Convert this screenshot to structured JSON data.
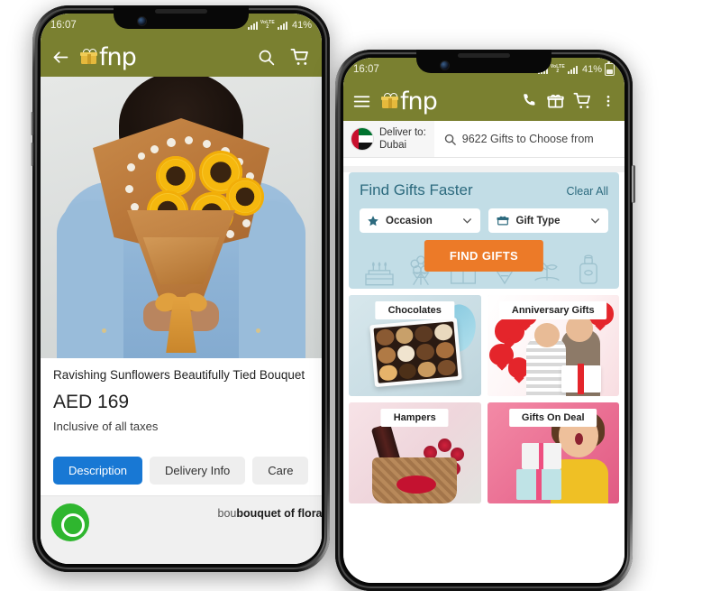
{
  "left_phone": {
    "status_bar": {
      "time": "16:07",
      "network1": "VoLTE1",
      "network2": "VoLTE2",
      "battery": "41%"
    },
    "app_bar": {
      "back_icon": "arrow-left-icon",
      "brand": "fnp",
      "search_icon": "search-icon",
      "cart_icon": "cart-icon"
    },
    "product": {
      "title": "Ravishing Sunflowers Beautifully Tied Bouquet",
      "price": "AED 169",
      "tax_note": "Inclusive of all taxes",
      "image_alt": "sunflower-bouquet-photo"
    },
    "tabs": [
      {
        "label": "Description",
        "active": true
      },
      {
        "label": "Delivery Info",
        "active": false
      },
      {
        "label": "Care",
        "active": false
      }
    ],
    "description_snippet": "bouquet of floral",
    "whatsapp_icon": "whatsapp-icon"
  },
  "right_phone": {
    "status_bar": {
      "time": "16:07",
      "network1": "VoLTE1",
      "network2": "VoLTE2",
      "battery": "41%"
    },
    "app_bar": {
      "menu_icon": "hamburger-menu-icon",
      "brand": "fnp",
      "call_icon": "phone-icon",
      "gift_icon": "gift-icon",
      "cart_icon": "cart-icon",
      "more_icon": "more-vertical-icon"
    },
    "location": {
      "label": "Deliver to:",
      "city": "Dubai",
      "flag": "uae-flag-icon"
    },
    "search": {
      "icon": "search-icon",
      "text": "9622 Gifts to Choose from"
    },
    "find_panel": {
      "title": "Find Gifts Faster",
      "clear_all": "Clear All",
      "selects": [
        {
          "icon": "star-icon",
          "label": "Occasion"
        },
        {
          "icon": "gift-box-icon",
          "label": "Gift Type"
        }
      ],
      "cta": "FIND GIFTS",
      "decor_icons": [
        "cake-icon",
        "bouquet-icon",
        "gift-box-icon",
        "chocolate-icon",
        "plant-icon",
        "perfume-icon"
      ]
    },
    "cards": [
      {
        "caption": "Chocolates",
        "art": "chocolates"
      },
      {
        "caption": "Anniversary Gifts",
        "art": "anniversary"
      },
      {
        "caption": "Hampers",
        "art": "hampers"
      },
      {
        "caption": "Gifts On Deal",
        "art": "deal"
      }
    ]
  },
  "colors": {
    "brand_olive": "#7a8030",
    "accent_orange": "#ec7a28",
    "panel_blue": "#c2dde6",
    "teal_text": "#2c6a7e",
    "tab_blue": "#1878d4",
    "logo_gold": "#e5b93c"
  }
}
